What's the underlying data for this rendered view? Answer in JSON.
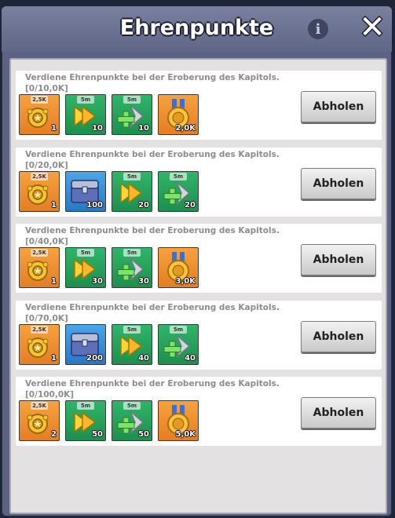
{
  "header": {
    "title": "Ehrenpunkte"
  },
  "rows": [
    {
      "desc": "Verdiene  Ehrenpunkte bei der Eroberung des Kapitols.",
      "progress": "[0/10,0K]",
      "button": "Abholen",
      "rewards": [
        {
          "icon": "honor-badge-icon",
          "tag": "2,5K",
          "amount": "1",
          "color": "orange"
        },
        {
          "icon": "speed-up-icon",
          "tag": "5m",
          "amount": "10",
          "color": "green"
        },
        {
          "icon": "heal-speedup-icon",
          "tag": "5m",
          "amount": "10",
          "color": "green"
        },
        {
          "icon": "honor-medal-icon",
          "tag": "",
          "amount": "2,0K",
          "color": "orange"
        }
      ]
    },
    {
      "desc": "Verdiene  Ehrenpunkte bei der Eroberung des Kapitols.",
      "progress": "[0/20,0K]",
      "button": "Abholen",
      "rewards": [
        {
          "icon": "honor-badge-icon",
          "tag": "2,5K",
          "amount": "1",
          "color": "orange"
        },
        {
          "icon": "resource-chest-icon",
          "tag": "",
          "amount": "100",
          "color": "blue"
        },
        {
          "icon": "speed-up-icon",
          "tag": "5m",
          "amount": "20",
          "color": "green"
        },
        {
          "icon": "heal-speedup-icon",
          "tag": "5m",
          "amount": "20",
          "color": "green"
        }
      ]
    },
    {
      "desc": "Verdiene  Ehrenpunkte bei der Eroberung des Kapitols.",
      "progress": "[0/40,0K]",
      "button": "Abholen",
      "rewards": [
        {
          "icon": "honor-badge-icon",
          "tag": "2,5K",
          "amount": "1",
          "color": "orange"
        },
        {
          "icon": "speed-up-icon",
          "tag": "5m",
          "amount": "30",
          "color": "green"
        },
        {
          "icon": "heal-speedup-icon",
          "tag": "5m",
          "amount": "30",
          "color": "green"
        },
        {
          "icon": "honor-medal-icon",
          "tag": "",
          "amount": "3,0K",
          "color": "orange"
        }
      ]
    },
    {
      "desc": "Verdiene  Ehrenpunkte bei der Eroberung des Kapitols.",
      "progress": "[0/70,0K]",
      "button": "Abholen",
      "rewards": [
        {
          "icon": "honor-badge-icon",
          "tag": "2,5K",
          "amount": "1",
          "color": "orange"
        },
        {
          "icon": "resource-chest-icon",
          "tag": "",
          "amount": "200",
          "color": "blue"
        },
        {
          "icon": "speed-up-icon",
          "tag": "5m",
          "amount": "40",
          "color": "green"
        },
        {
          "icon": "heal-speedup-icon",
          "tag": "5m",
          "amount": "40",
          "color": "green"
        }
      ]
    },
    {
      "desc": "Verdiene  Ehrenpunkte bei der Eroberung des Kapitols.",
      "progress": "[0/100,0K]",
      "button": "Abholen",
      "rewards": [
        {
          "icon": "honor-badge-icon",
          "tag": "2,5K",
          "amount": "2",
          "color": "orange"
        },
        {
          "icon": "speed-up-icon",
          "tag": "5m",
          "amount": "50",
          "color": "green"
        },
        {
          "icon": "heal-speedup-icon",
          "tag": "5m",
          "amount": "50",
          "color": "green"
        },
        {
          "icon": "honor-medal-icon",
          "tag": "",
          "amount": "5,0K",
          "color": "orange"
        }
      ]
    }
  ]
}
